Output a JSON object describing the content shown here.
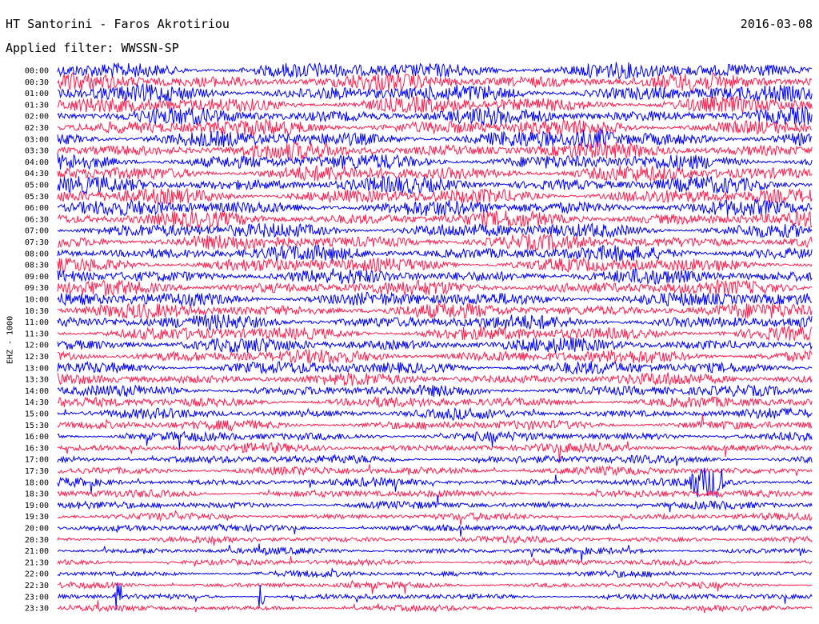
{
  "header": {
    "station": "HT Santorini - Faros Akrotiriou",
    "date": "2016-03-08",
    "filter_label": "Applied filter: WWSSN-SP"
  },
  "channel_label": "EHZ - 1000",
  "colors": {
    "trace_a": "#0000ff",
    "trace_b": "#ff1f4f",
    "background": "#ffffff"
  },
  "chart_data": {
    "type": "line",
    "title": "HT Santorini - Faros Akrotiriou",
    "ylabel": "EHZ - 1000",
    "row_labels": [
      "00:00",
      "00:30",
      "01:00",
      "01:30",
      "02:00",
      "02:30",
      "03:00",
      "03:30",
      "04:00",
      "04:30",
      "05:00",
      "05:30",
      "06:00",
      "06:30",
      "07:00",
      "07:30",
      "08:00",
      "08:30",
      "09:00",
      "09:30",
      "10:00",
      "10:30",
      "11:00",
      "11:30",
      "12:00",
      "12:30",
      "13:00",
      "13:30",
      "14:00",
      "14:30",
      "15:00",
      "15:30",
      "16:00",
      "16:30",
      "17:00",
      "17:30",
      "18:00",
      "18:30",
      "19:00",
      "19:30",
      "20:00",
      "20:30",
      "21:00",
      "21:30",
      "22:00",
      "22:30",
      "23:00",
      "23:30"
    ],
    "row_colors": [
      "blue",
      "red",
      "blue",
      "red",
      "blue",
      "red",
      "blue",
      "red",
      "blue",
      "red",
      "blue",
      "red",
      "blue",
      "red",
      "blue",
      "red",
      "blue",
      "red",
      "blue",
      "red",
      "blue",
      "red",
      "blue",
      "red",
      "blue",
      "red",
      "blue",
      "red",
      "blue",
      "red",
      "blue",
      "red",
      "blue",
      "red",
      "blue",
      "red",
      "blue",
      "red",
      "blue",
      "red",
      "blue",
      "red",
      "blue",
      "red",
      "blue",
      "red",
      "blue",
      "red"
    ],
    "noise_level": [
      1.0,
      1.0,
      1.0,
      0.98,
      0.97,
      0.97,
      0.96,
      0.95,
      0.95,
      0.94,
      0.93,
      0.92,
      0.92,
      0.9,
      0.9,
      0.88,
      0.88,
      0.86,
      0.85,
      0.84,
      0.83,
      0.82,
      0.82,
      0.8,
      0.8,
      0.78,
      0.72,
      0.65,
      0.58,
      0.52,
      0.46,
      0.44,
      0.42,
      0.4,
      0.38,
      0.36,
      0.32,
      0.3,
      0.26,
      0.24,
      0.22,
      0.2,
      0.18,
      0.17,
      0.16,
      0.15,
      0.14,
      0.13
    ],
    "events": [
      {
        "row": "03:00",
        "position": 0.69,
        "width": 0.012,
        "amplitude": 1.0
      },
      {
        "row": "03:00",
        "position": 0.72,
        "width": 0.015,
        "amplitude": 1.0
      },
      {
        "row": "18:00",
        "position": 0.86,
        "width": 0.025,
        "amplitude": 1.6
      },
      {
        "row": "23:00",
        "position": 0.08,
        "width": 0.004,
        "amplitude": 1.5
      },
      {
        "row": "23:00",
        "position": 0.27,
        "width": 0.004,
        "amplitude": 1.3
      }
    ],
    "grid": false,
    "legend": "none"
  }
}
